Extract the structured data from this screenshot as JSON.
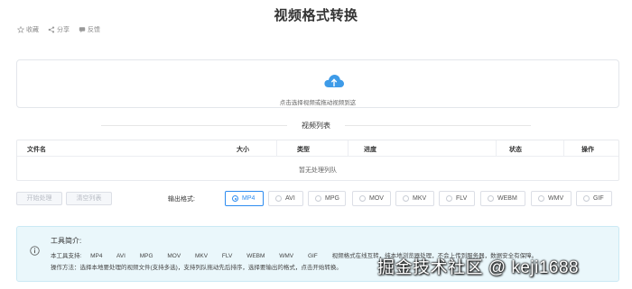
{
  "page": {
    "title": "视频格式转换"
  },
  "actions": [
    {
      "label": "收藏",
      "icon": "star-icon"
    },
    {
      "label": "分享",
      "icon": "share-icon"
    },
    {
      "label": "反馈",
      "icon": "feedback-icon"
    }
  ],
  "upload": {
    "hint": "点击选择视频或拖动视频到这",
    "icon": "cloud-upload-icon",
    "accent": "#3e9be8"
  },
  "list": {
    "title": "视频列表",
    "columns": [
      "文件名",
      "大小",
      "类型",
      "进度",
      "状态",
      "操作"
    ],
    "empty": "暂无处理列队"
  },
  "buttons": {
    "start": "开始处理",
    "clear": "清空列表"
  },
  "output": {
    "label": "输出格式:",
    "formats": [
      "MP4",
      "AVI",
      "MPG",
      "MOV",
      "MKV",
      "FLV",
      "WEBM",
      "WMV",
      "GIF"
    ],
    "selected": "MP4",
    "accent": "#2d8cf0"
  },
  "intro": {
    "title": "工具简介:",
    "support_label": "本工具支持:",
    "formats": [
      "MP4",
      "AVI",
      "MPG",
      "MOV",
      "MKV",
      "FLV",
      "WEBM",
      "WMV",
      "GIF"
    ],
    "support_text": "视频格式在线互转，纯本地浏览器处理，不会上传到服务器，数据安全有保障。",
    "usage": "操作方法：选择本地要处理的视频文件(支持多选)，支持列队拖动先后排序，选择要输出的格式，点击开始转换。"
  },
  "watermark": "掘金技术社区 @ keji1688"
}
